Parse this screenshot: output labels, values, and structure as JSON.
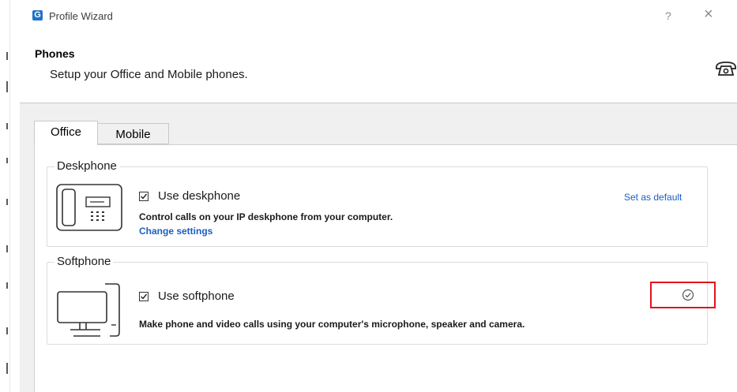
{
  "window": {
    "app_icon_letter": "G",
    "title": "Profile Wizard",
    "help_label": "?",
    "close_label": "×"
  },
  "header": {
    "title": "Phones",
    "subtitle": "Setup your Office and Mobile phones.",
    "icon": "phone-icon"
  },
  "tabs": [
    {
      "label": "Office",
      "selected": true
    },
    {
      "label": "Mobile",
      "selected": false
    }
  ],
  "deskphone": {
    "group_label": "Deskphone",
    "checkbox_label": "Use deskphone",
    "checked": true,
    "description": "Control calls on your IP deskphone from your computer.",
    "settings_link": "Change settings",
    "default_link": "Set as default",
    "icon": "deskphone-icon"
  },
  "softphone": {
    "group_label": "Softphone",
    "checkbox_label": "Use softphone",
    "checked": true,
    "description": "Make phone and video calls using your computer's microphone, speaker and camera.",
    "default_indicator_icon": "check-circle-icon",
    "icon": "computer-icon"
  },
  "colors": {
    "accent": "#1a5fc2",
    "app_icon": "#1f73c9",
    "highlight": "#e0141e",
    "content_bg": "#f0f0f0"
  }
}
